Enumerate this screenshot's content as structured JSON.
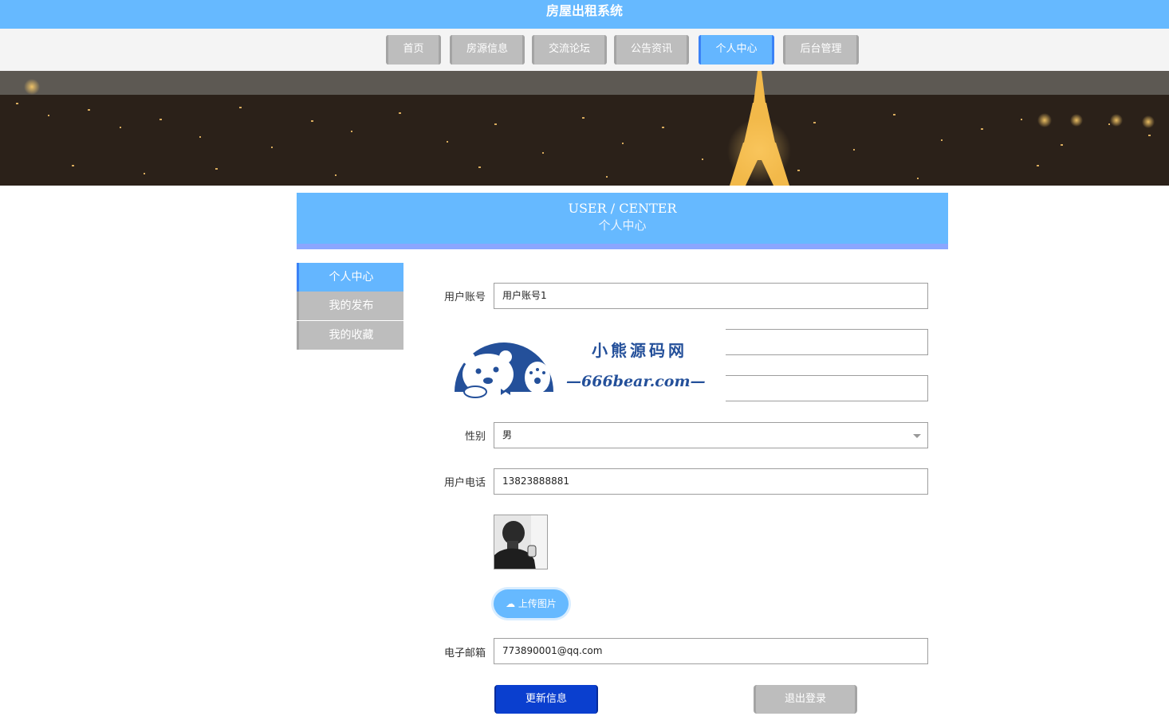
{
  "header": {
    "title": "房屋出租系统"
  },
  "nav": [
    {
      "label": "首页",
      "active": false
    },
    {
      "label": "房源信息",
      "active": false
    },
    {
      "label": "交流论坛",
      "active": false
    },
    {
      "label": "公告资讯",
      "active": false
    },
    {
      "label": "个人中心",
      "active": true
    },
    {
      "label": "后台管理",
      "active": false
    }
  ],
  "section": {
    "title_en": "USER / CENTER",
    "title_cn": "个人中心"
  },
  "sidebar": [
    {
      "label": "个人中心",
      "active": true
    },
    {
      "label": "我的发布",
      "active": false
    },
    {
      "label": "我的收藏",
      "active": false
    }
  ],
  "form": {
    "account": {
      "label": "用户账号",
      "value": "用户账号1"
    },
    "gender": {
      "label": "性别",
      "value": "男"
    },
    "phone": {
      "label": "用户电话",
      "value": "13823888881"
    },
    "upload_label": "上传图片",
    "email": {
      "label": "电子邮箱",
      "value": "773890001@qq.com"
    }
  },
  "buttons": {
    "update": "更新信息",
    "logout": "退出登录"
  },
  "watermark": {
    "line1": "小熊源码网",
    "line2": "—666bear.com—"
  },
  "colors": {
    "accent": "#66b9ff",
    "primary_button": "#0a3fcf",
    "inactive": "#bdbdbd"
  }
}
